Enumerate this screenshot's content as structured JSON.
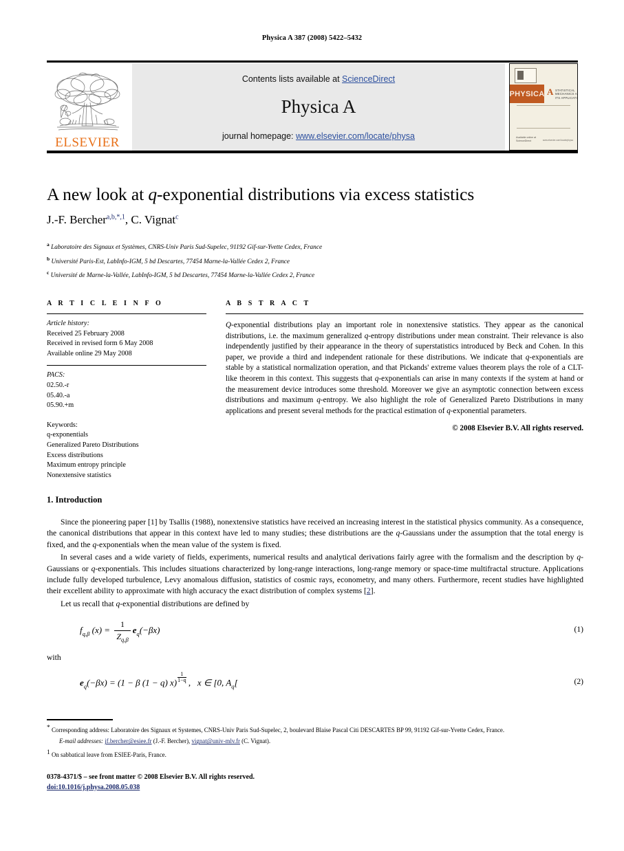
{
  "running_head": "Physica A 387 (2008) 5422–5432",
  "masthead": {
    "logo_word": "ELSEVIER",
    "contents_prefix": "Contents lists available at ",
    "contents_link": "ScienceDirect",
    "journal_name": "Physica A",
    "homepage_prefix": "journal homepage: ",
    "homepage_url": "www.elsevier.com/locate/physa",
    "cover": {
      "band_title": "PHYSICA",
      "band_letter": "A",
      "band_subtitle": "STATISTICAL MECHANICS AND ITS APPLICATIONS",
      "foot_left": "Available online at",
      "foot_left2": "ScienceDirect",
      "foot_right": "www.elsevier.com/locate/physa"
    }
  },
  "article": {
    "title_pre": "A new look at ",
    "title_italic": "q",
    "title_post": "-exponential distributions via excess statistics",
    "author1": "J.-F. Bercher",
    "author1_sup": "a,b,*,1",
    "author_sep": ", ",
    "author2": "C. Vignat",
    "author2_sup": "c",
    "affiliations": [
      {
        "mark": "a",
        "text": "Laboratoire des Signaux et Systèmes, CNRS-Univ Paris Sud-Supelec, 91192 Gif-sur-Yvette Cedex, France"
      },
      {
        "mark": "b",
        "text": "Université Paris-Est, LabInfo-IGM, 5 bd Descartes, 77454 Marne-la-Vallée Cedex 2, France"
      },
      {
        "mark": "c",
        "text": "Université de Marne-la-Vallée, LabInfo-IGM, 5 bd Descartes, 77454 Marne-la-Vallée Cedex 2, France"
      }
    ]
  },
  "info": {
    "heading": "A R T I C L E    I N F O",
    "history_label": "Article history:",
    "history": [
      "Received 25 February 2008",
      "Received in revised form 6 May 2008",
      "Available online 29 May 2008"
    ],
    "pacs_label": "PACS:",
    "pacs": [
      "02.50.-r",
      "05.40.-a",
      "05.90.+m"
    ],
    "keywords_label": "Keywords:",
    "keywords": [
      "q-exponentials",
      "Generalized Pareto Distributions",
      "Excess distributions",
      "Maximum entropy principle",
      "Nonextensive statistics"
    ]
  },
  "abstract": {
    "heading": "A B S T R A C T",
    "p1a": "Q",
    "p1b": "-exponential distributions play an important role in nonextensive statistics. They appear as the canonical distributions, i.e. the maximum generalized ",
    "p1c": "q",
    "p1d": "-entropy distributions under mean constraint. Their relevance is also independently justified by their appearance in the theory of superstatistics introduced by Beck and Cohen. In this paper, we provide a third and independent rationale for these distributions. We indicate that ",
    "p1e": "q",
    "p1f": "-exponentials are stable by a statistical normalization operation, and that Pickands' extreme values theorem plays the role of a CLT-like theorem in this context. This suggests that ",
    "p1g": "q",
    "p1h": "-exponentials can arise in many contexts if the system at hand or the measurement device introduces some threshold. Moreover we give an asymptotic connection between excess distributions and maximum ",
    "p1i": "q",
    "p1j": "-entropy. We also highlight the role of Generalized Pareto Distributions in many applications and present several methods for the practical estimation of ",
    "p1k": "q",
    "p1l": "-exponential parameters.",
    "copyright": "© 2008 Elsevier B.V. All rights reserved."
  },
  "body": {
    "section_title": "1.  Introduction",
    "para1_a": "Since the pioneering paper [1] by Tsallis (1988),  nonextensive statistics have received an increasing interest in the statistical physics community. As a consequence, the canonical distributions that appear in this context have led to many studies; these distributions are the ",
    "para1_b": "q",
    "para1_c": "-Gaussians under the assumption that the total energy is fixed, and the ",
    "para1_d": "q",
    "para1_e": "-exponentials when the mean value of the system is fixed.",
    "para2_a": "In several cases and a wide variety of fields, experiments, numerical results and analytical derivations fairly agree with the formalism and the description by ",
    "para2_b": "q",
    "para2_c": "-Gaussians or ",
    "para2_d": "q",
    "para2_e": "-exponentials. This includes situations characterized by long-range interactions, long-range memory or space-time multifractal structure. Applications include fully developed turbulence, Levy anomalous diffusion, statistics of cosmic rays, econometry, and many others. Furthermore, recent studies have highlighted their excellent ability to approximate with high accuracy the exact distribution of complex systems [",
    "para2_cite": "2",
    "para2_f": "].",
    "para3_a": "Let us recall that ",
    "para3_b": "q",
    "para3_c": "-exponential distributions are defined by",
    "with_word": "with",
    "eq1_num": "(1)",
    "eq2_num": "(2)"
  },
  "footnotes": {
    "star_mark": "*",
    "star_text": "Corresponding address: Laboratoire des Signaux et Systemes, CNRS-Univ Paris Sud-Supelec, 2, boulevard Blaise Pascal Citi DESCARTES BP 99, 91192 Gif-sur-Yvette Cedex, France.",
    "email_label": "E-mail addresses:",
    "email1": "jf.bercher@esiee.fr",
    "email1_who": " (J.-F. Bercher), ",
    "email2": "vignat@univ-mlv.fr",
    "email2_who": " (C. Vignat).",
    "one_mark": "1",
    "one_text": "On sabbatical leave from ESIEE-Paris, France."
  },
  "imprint": {
    "issn_line": "0378-4371/$ – see front matter © 2008 Elsevier B.V. All rights reserved.",
    "doi": "doi:10.1016/j.physa.2008.05.038"
  },
  "colors": {
    "link_blue": "#2c4f9e",
    "dark_blue": "#1f2d6e",
    "elsevier_orange": "#E8711A",
    "box_gray": "#e9e9e9"
  }
}
